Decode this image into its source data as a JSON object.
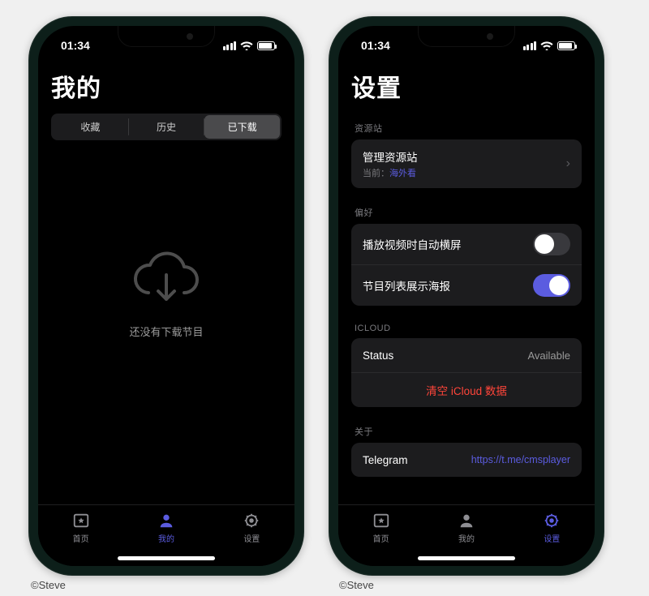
{
  "status": {
    "time": "01:34"
  },
  "credit": "©Steve",
  "accent": "#5b5ce0",
  "phone1": {
    "title": "我的",
    "tabs": {
      "fav": "收藏",
      "history": "历史",
      "downloaded": "已下载"
    },
    "empty_text": "还没有下载节目"
  },
  "phone2": {
    "title": "设置",
    "sections": {
      "source": {
        "label": "资源站",
        "manage": "管理资源站",
        "current_prefix": "当前：",
        "current_value": "海外看"
      },
      "pref": {
        "label": "偏好",
        "auto_landscape": "播放视频时自动横屏",
        "show_poster": "节目列表展示海报"
      },
      "icloud": {
        "label": "ICLOUD",
        "status_key": "Status",
        "status_val": "Available",
        "clear": "清空 iCloud 数据"
      },
      "about": {
        "label": "关于",
        "telegram": "Telegram",
        "url": "https://t.me/cmsplayer"
      }
    }
  },
  "tabbar": {
    "home": "首页",
    "mine": "我的",
    "settings": "设置"
  }
}
